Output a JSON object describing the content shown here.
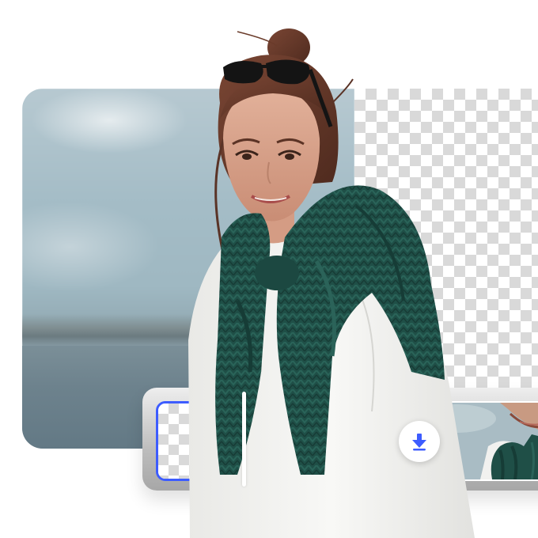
{
  "scene": {
    "subject": "woman-with-green-sweater",
    "background_style": "checkerboard-transparency"
  },
  "colors": {
    "accent": "#3d5cff",
    "sweater": "#1f4f47",
    "shirt": "#f4f4f2",
    "hair": "#6a3b2a",
    "checker_dark": "#d9d9d9",
    "checker_light": "#ffffff"
  },
  "icons": {
    "download": "download-arrow-icon"
  },
  "compare": {
    "slider_position_fraction": 0.35
  }
}
